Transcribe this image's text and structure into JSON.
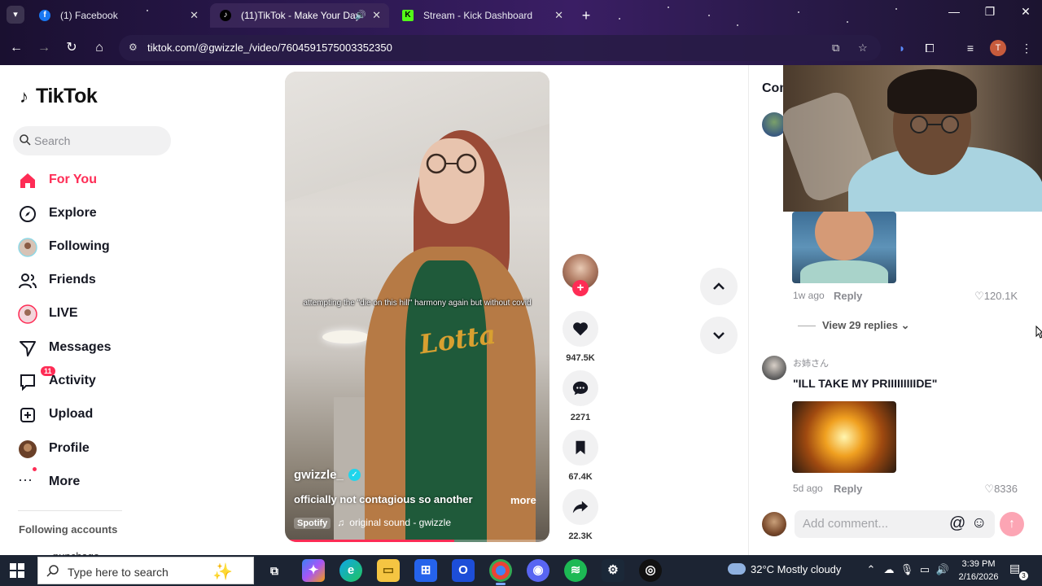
{
  "browser": {
    "tabs": [
      {
        "title": "(1) Facebook",
        "favicon": "facebook-icon",
        "color": "#1877f2"
      },
      {
        "title": "(11)TikTok - Make Your Day",
        "favicon": "tiktok-icon",
        "color": "#000000",
        "active": true,
        "audio": true
      },
      {
        "title": "Stream - Kick Dashboard",
        "favicon": "kick-icon",
        "color": "#53fc18"
      }
    ],
    "url": "tiktok.com/@gwizzle_/video/7604591575003352350",
    "profile_initial": "T"
  },
  "sidebar": {
    "logo": "TikTok",
    "search_placeholder": "Search",
    "items": [
      {
        "label": "For You",
        "icon": "home-icon",
        "active": true
      },
      {
        "label": "Explore",
        "icon": "compass-icon"
      },
      {
        "label": "Following",
        "icon": "following-avatar-icon"
      },
      {
        "label": "Friends",
        "icon": "friends-icon"
      },
      {
        "label": "LIVE",
        "icon": "live-icon"
      },
      {
        "label": "Messages",
        "icon": "send-icon"
      },
      {
        "label": "Activity",
        "icon": "activity-icon",
        "badge": "11"
      },
      {
        "label": "Upload",
        "icon": "upload-icon"
      },
      {
        "label": "Profile",
        "icon": "profile-avatar-icon"
      },
      {
        "label": "More",
        "icon": "more-dots-icon"
      }
    ],
    "following_accounts_label": "Following accounts",
    "cut_account": "punchago"
  },
  "video": {
    "caption_overlay": "attempting the \"die on this hill\" harmony again but without covid",
    "shirt_print": "Lotta",
    "username": "gwizzle_",
    "description": "officially not contagious so another",
    "more_label": "more",
    "music_source": "Spotify",
    "music": "original sound - gwizzle",
    "progress": 0.64
  },
  "actions": {
    "likes": "947.5K",
    "comments": "2271",
    "saves": "67.4K",
    "shares": "22.3K"
  },
  "comments": {
    "header": "Comments",
    "items": [
      {
        "time": "1w ago",
        "reply": "Reply",
        "likes": "120.1K"
      },
      {
        "view_replies": "View 29 replies"
      },
      {
        "name": "お姉さん",
        "text": "\"ILL TAKE MY PRIIIIIIIIIDE\"",
        "time": "5d ago",
        "reply": "Reply",
        "likes": "8336"
      }
    ],
    "add_placeholder": "Add comment..."
  },
  "taskbar": {
    "search_placeholder": "Type here to search",
    "weather": "32°C  Mostly cloudy",
    "time": "3:39 PM",
    "date": "2/16/2026",
    "notif_count": "3"
  },
  "colors": {
    "accent": "#fe2c55",
    "verified": "#20d5ec"
  }
}
